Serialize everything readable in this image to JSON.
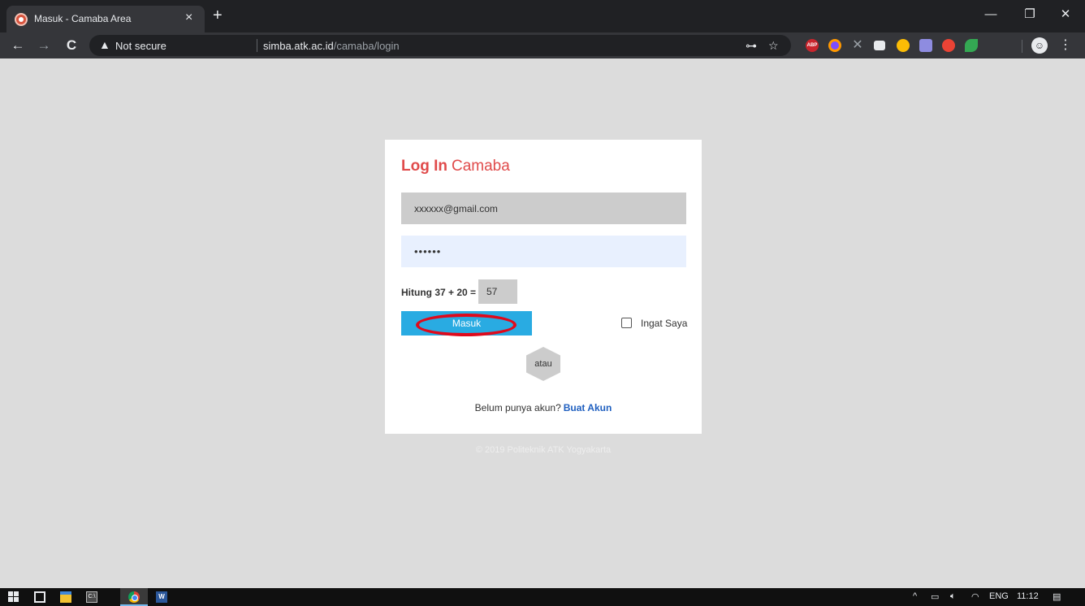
{
  "browser": {
    "tab_title": "Masuk - Camaba Area",
    "tab_close": "×",
    "new_tab": "+",
    "window_controls": {
      "minimize": "—",
      "restore": "❐",
      "close": "✕"
    },
    "nav": {
      "back": "←",
      "forward": "→",
      "reload": "C"
    },
    "address": {
      "warning_icon": "warning-triangle-icon",
      "security_label": "Not secure",
      "host": "simba.atk.ac.id",
      "path": "/camaba/login"
    },
    "omnibox_icons": [
      "key-icon",
      "star-icon"
    ],
    "extension_badge_abp": "ABP"
  },
  "login": {
    "title_strong": "Log In",
    "title_light": "Camaba",
    "email_value": "xxxxxx@gmail.com",
    "password_mask": "••••••",
    "captcha_label": "Hitung 37 + 20 =",
    "captcha_value": "57",
    "submit_label": "Masuk",
    "remember_label": "Ingat Saya",
    "divider_text": "atau",
    "signup_prompt": "Belum punya akun?",
    "signup_link": "Buat Akun"
  },
  "footer": {
    "text": "© 2019 Politeknik ATK Yogyakarta"
  },
  "taskbar": {
    "tray_chevron": "^",
    "language": "ENG",
    "time": "11:12"
  },
  "colors": {
    "accent_red": "#e04b4b",
    "button_blue": "#29abe2",
    "link_blue": "#2060c0",
    "highlight_red": "#e0091b"
  }
}
